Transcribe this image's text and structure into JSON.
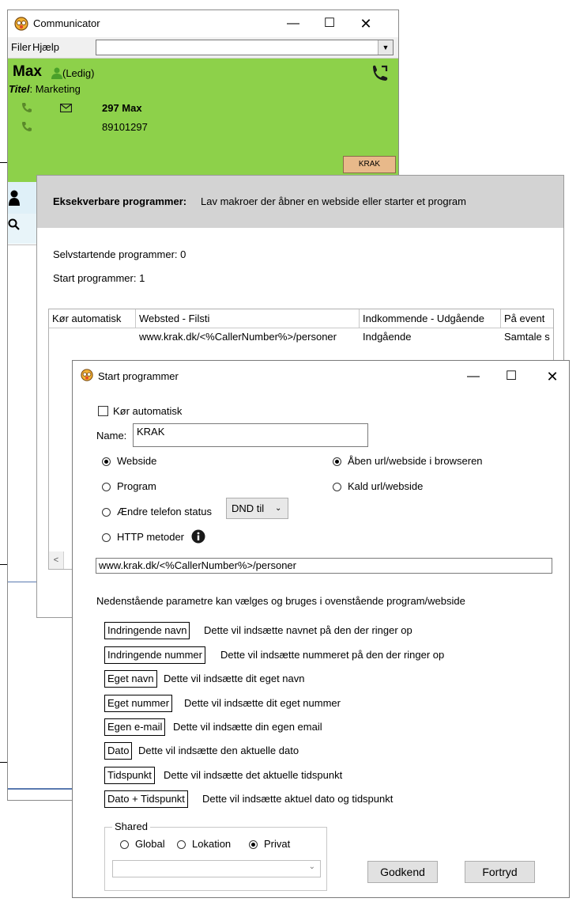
{
  "communicator": {
    "title": "Communicator",
    "menu": [
      "Filer",
      "Hjælp"
    ],
    "contact": {
      "name": "Max",
      "status": "(Ledig)",
      "title_label": "Titel",
      "title_value": ": Marketing",
      "extension": "297 Max",
      "number": "89101297",
      "krak_button": "KRAK"
    }
  },
  "exe_panel": {
    "header_bold": "Eksekverbare programmer:",
    "header_text": "Lav makroer der åbner en webside eller starter et program",
    "auto_start": "Selvstartende programmer: 0",
    "start_programs": "Start programmer: 1",
    "columns": [
      "Kør automatisk",
      "Websted - Filsti",
      "Indkommende - Udgående",
      "På event"
    ],
    "rows": [
      [
        "",
        "www.krak.dk/<%CallerNumber%>/personer",
        "Indgående",
        "Samtale s"
      ]
    ]
  },
  "dialog": {
    "title": "Start programmer",
    "run_auto_label": "Kør automatisk",
    "name_label": "Name:",
    "name_value": "KRAK",
    "options_left": [
      {
        "label": "Webside",
        "selected": true
      },
      {
        "label": "Program",
        "selected": false
      },
      {
        "label": "Ændre telefon status",
        "selected": false
      },
      {
        "label": "HTTP metoder",
        "selected": false
      }
    ],
    "status_select": "DND til",
    "options_right": [
      {
        "label": "Åben url/webside i browseren",
        "selected": true
      },
      {
        "label": "Kald url/webside",
        "selected": false
      }
    ],
    "url_value": "www.krak.dk/<%CallerNumber%>/personer",
    "params_intro": "Nedenstående parametre kan vælges og bruges i ovenstående program/webside",
    "params": [
      {
        "tag": "Indringende navn",
        "desc": "Dette vil indsætte navnet på den der ringer op"
      },
      {
        "tag": "Indringende nummer",
        "desc": "Dette vil indsætte nummeret på den der ringer op"
      },
      {
        "tag": "Eget navn",
        "desc": "Dette vil indsætte dit eget navn"
      },
      {
        "tag": "Eget nummer",
        "desc": "Dette vil indsætte dit eget nummer"
      },
      {
        "tag": "Egen e-mail",
        "desc": "Dette vil indsætte din egen email"
      },
      {
        "tag": "Dato",
        "desc": "Dette vil indsætte den aktuelle dato"
      },
      {
        "tag": "Tidspunkt",
        "desc": "Dette vil indsætte det aktuelle tidspunkt"
      },
      {
        "tag": "Dato + Tidspunkt",
        "desc": "Dette vil indsætte aktuel dato og tidspunkt"
      }
    ],
    "shared_label": "Shared",
    "shared_options": [
      {
        "label": "Global",
        "selected": false
      },
      {
        "label": "Lokation",
        "selected": false
      },
      {
        "label": "Privat",
        "selected": true
      }
    ],
    "ok_button": "Godkend",
    "cancel_button": "Fortryd"
  },
  "colors": {
    "contact_green": "#8dd14a",
    "krak_button_bg": "#e8b98a",
    "header_gray": "#d3d3d3",
    "phone_icon": "#5a8a2a"
  }
}
